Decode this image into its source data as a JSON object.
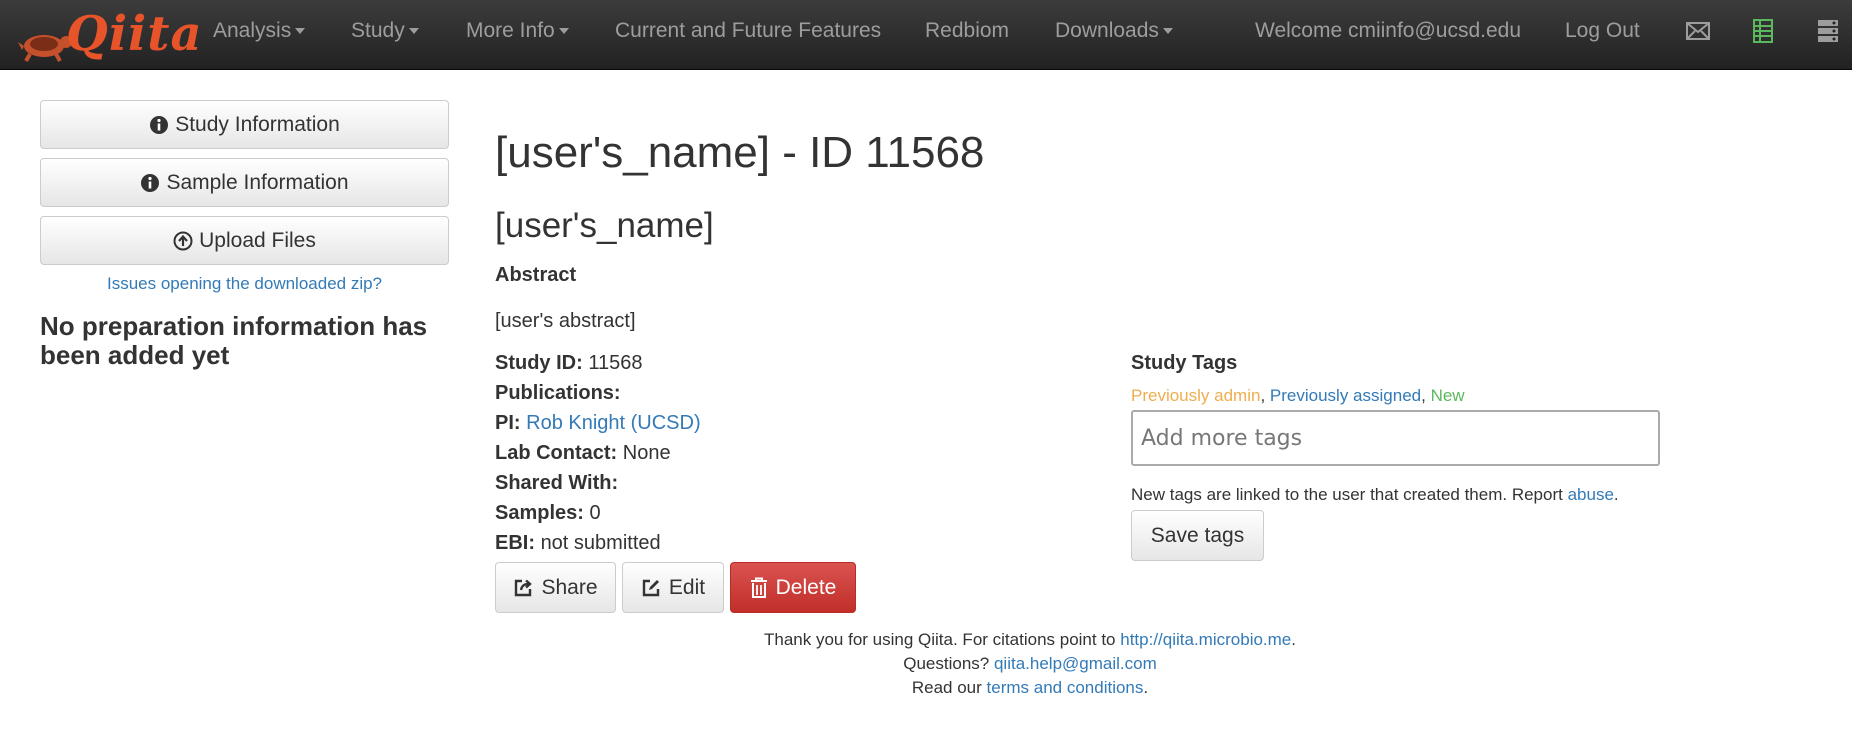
{
  "navbar": {
    "brand": "Qiita",
    "items": [
      {
        "label": "Analysis"
      },
      {
        "label": "Study"
      },
      {
        "label": "More Info"
      },
      {
        "label": "Current and Future Features"
      },
      {
        "label": "Redbiom"
      },
      {
        "label": "Downloads"
      }
    ],
    "welcome": "Welcome cmiinfo@ucsd.edu",
    "logout": "Log Out",
    "icons": [
      "envelope-icon",
      "spreadsheet-icon",
      "server-icon"
    ],
    "colors": {
      "accent": "#e8542a",
      "sheet_icon": "#5cb85c"
    }
  },
  "sidebar": {
    "buttons": [
      {
        "label": "Study Information",
        "icon": "info-icon"
      },
      {
        "label": "Sample Information",
        "icon": "info-icon"
      },
      {
        "label": "Upload Files",
        "icon": "upload-icon"
      }
    ],
    "issues_link": "Issues opening the downloaded zip?",
    "no_prep": "No preparation information has been added yet"
  },
  "main": {
    "title": "[user's_name] - ID 11568",
    "study_name": "[user's_name]",
    "abstract_heading": "Abstract",
    "abstract_text": "[user's abstract]",
    "info": {
      "study_id_label": "Study ID:",
      "study_id": "11568",
      "publications_label": "Publications:",
      "pi_label": "PI:",
      "pi": "Rob Knight (UCSD)",
      "lab_contact_label": "Lab Contact:",
      "lab_contact": "None",
      "shared_with_label": "Shared With:",
      "samples_label": "Samples:",
      "samples": "0",
      "ebi_label": "EBI:",
      "ebi": "not submitted"
    },
    "actions": {
      "share": "Share",
      "edit": "Edit",
      "delete": "Delete"
    }
  },
  "tags": {
    "heading": "Study Tags",
    "legend": [
      {
        "label": "Previously admin",
        "color": "#f0ad4e"
      },
      {
        "label": "Previously assigned",
        "color": "#337ab7"
      },
      {
        "label": "New",
        "color": "#5cb85c"
      }
    ],
    "placeholder": "Add more tags",
    "note": "New tags are linked to the user that created them. Report",
    "abuse": "abuse",
    "save": "Save tags"
  },
  "footer": {
    "thanks": "Thank you for using Qiita. For citations point to",
    "site_link": "http://qiita.microbio.me",
    "questions": "Questions?",
    "email": "qiita.help@gmail.com",
    "read": "Read our",
    "terms": "terms and conditions"
  }
}
